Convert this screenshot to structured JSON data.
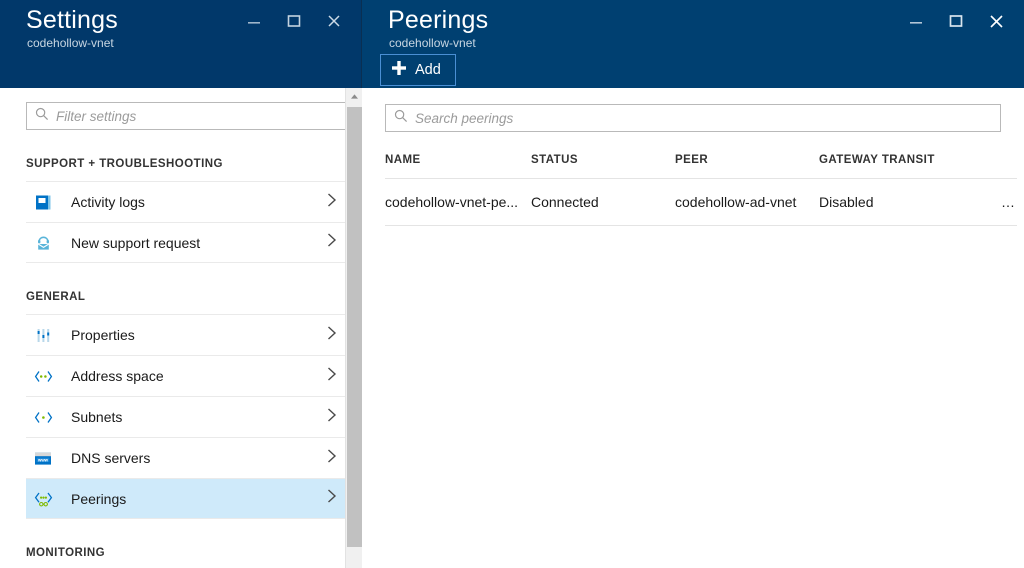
{
  "left_blade": {
    "title": "Settings",
    "subtitle": "codehollow-vnet",
    "window_controls": {
      "minimize": "minimize-icon",
      "maximize": "maximize-icon",
      "close": "close-icon"
    },
    "filter": {
      "placeholder": "Filter settings",
      "value": "",
      "icon": "search-icon"
    },
    "groups": [
      {
        "header": "SUPPORT + TROUBLESHOOTING",
        "items": [
          {
            "label": "Activity logs",
            "icon": "activity-log-book-icon",
            "selected": false
          },
          {
            "label": "New support request",
            "icon": "support-headset-icon",
            "selected": false
          }
        ]
      },
      {
        "header": "GENERAL",
        "items": [
          {
            "label": "Properties",
            "icon": "sliders-icon",
            "selected": false
          },
          {
            "label": "Address space",
            "icon": "address-space-icon",
            "selected": false
          },
          {
            "label": "Subnets",
            "icon": "subnets-icon",
            "selected": false
          },
          {
            "label": "DNS servers",
            "icon": "dns-www-icon",
            "selected": false
          },
          {
            "label": "Peerings",
            "icon": "peerings-icon",
            "selected": true
          }
        ]
      },
      {
        "header": "MONITORING",
        "items": []
      }
    ],
    "scrollbar": {
      "up_arrow": "chevron-up-icon"
    }
  },
  "right_blade": {
    "title": "Peerings",
    "subtitle": "codehollow-vnet",
    "window_controls": {
      "minimize": "minimize-icon",
      "maximize": "maximize-icon",
      "close": "close-icon"
    },
    "commands": {
      "add_label": "Add",
      "add_icon": "plus-icon"
    },
    "search": {
      "placeholder": "Search peerings",
      "value": "",
      "icon": "search-icon"
    },
    "table": {
      "columns": [
        "NAME",
        "STATUS",
        "PEER",
        "GATEWAY TRANSIT"
      ],
      "rows": [
        {
          "name": "codehollow-vnet-pe...",
          "status": "Connected",
          "peer": "codehollow-ad-vnet",
          "gateway_transit": "Disabled",
          "actions": "…"
        }
      ]
    }
  },
  "colors": {
    "blade_header_left": "#01386a",
    "blade_header_right": "#004071",
    "selection": "#cfeafa",
    "accent_border": "#4a8fd4",
    "icon_blue": "#0072c6",
    "icon_light_blue": "#59b4d9",
    "icon_green": "#7fba00"
  }
}
